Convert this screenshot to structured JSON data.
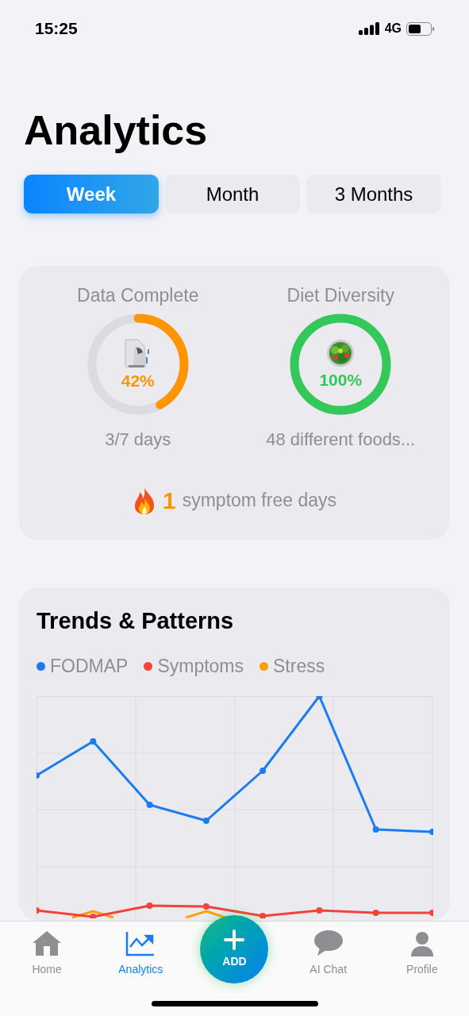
{
  "status_bar": {
    "time": "15:25",
    "network": "4G"
  },
  "title": "Analytics",
  "tabs": [
    {
      "label": "Week",
      "selected": true
    },
    {
      "label": "Month",
      "selected": false
    },
    {
      "label": "3 Months",
      "selected": false
    }
  ],
  "summary": {
    "meters": [
      {
        "title": "Data Complete",
        "value": "42%",
        "level": 0.42,
        "color": "#ff9500",
        "caption": "3/7 days"
      },
      {
        "title": "Diet Diversity",
        "value": "100%",
        "level": 1,
        "color": "#34c759",
        "caption": "48 different foods..."
      }
    ],
    "streak": {
      "count": "1",
      "label": "symptom free days"
    }
  },
  "trends": {
    "title": "Trends & Patterns",
    "legend": [
      {
        "label": "FODMAP",
        "color": "#1a7cf0"
      },
      {
        "label": "Symptoms",
        "color": "#f04438"
      },
      {
        "label": "Stress",
        "color": "#ff9f0a"
      }
    ]
  },
  "nav": [
    {
      "kind": "tab",
      "label": "Home",
      "selected": false
    },
    {
      "kind": "tab",
      "label": "Analytics",
      "selected": true
    },
    {
      "kind": "add",
      "label": "ADD",
      "selected": false
    },
    {
      "kind": "tab",
      "label": "AI Chat",
      "selected": false
    },
    {
      "kind": "tab",
      "label": "Profile",
      "selected": false
    }
  ]
}
